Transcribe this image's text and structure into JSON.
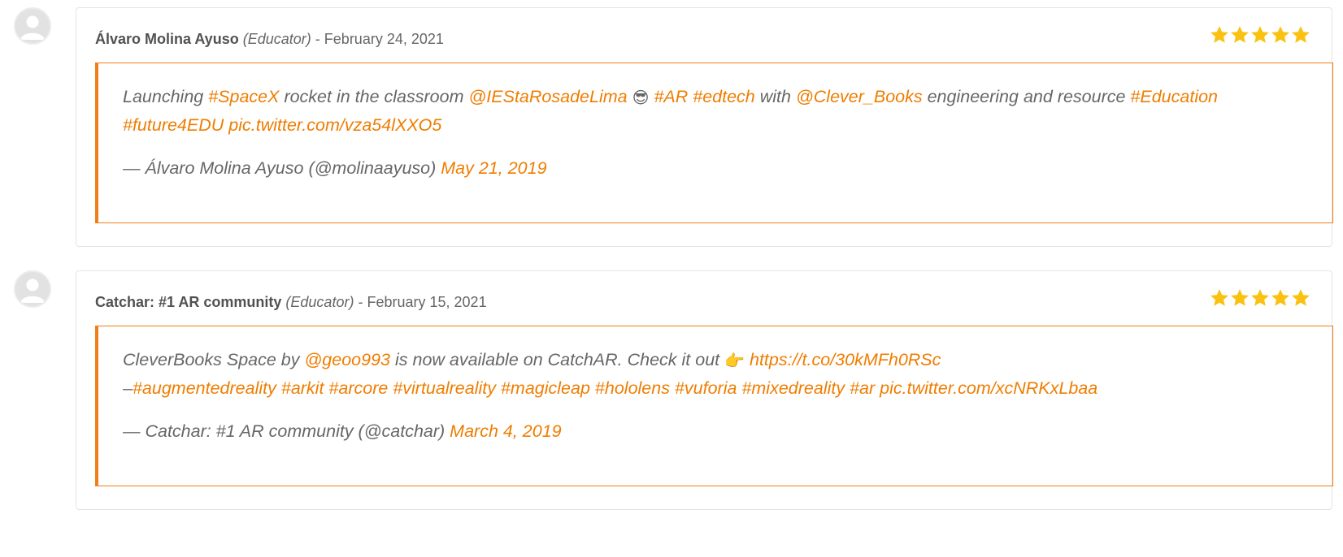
{
  "colors": {
    "accent": "#ef7d00",
    "star": "#fbc10f",
    "text": "#666666",
    "author": "#515151"
  },
  "reviews": [
    {
      "author": "Álvaro Molina Ayuso",
      "role": "(Educator)",
      "separator": "-",
      "date": "February 24, 2021",
      "rating": 5,
      "tweet": {
        "t1": "Launching ",
        "l1": "#SpaceX",
        "t2": " rocket in the classroom ",
        "l2": "@IEStaRosadeLima",
        "emoji": "😎",
        "l3": "#AR",
        "l4": "#edtech",
        "t3": " with ",
        "l5": "@Clever_Books",
        "t4": " engineering and resource ",
        "l6": "#Education",
        "l7": "#future4EDU",
        "l8": "pic.twitter.com/vza54lXXO5",
        "sig_text": "— Álvaro Molina Ayuso (@molinaayuso) ",
        "sig_date": "May 21, 2019"
      }
    },
    {
      "author": "Catchar: #1 AR community",
      "role": "(Educator)",
      "separator": "-",
      "date": "February 15, 2021",
      "rating": 5,
      "tweet": {
        "t1": "CleverBooks Space by ",
        "l1": "@geoo993",
        "t2": " is now available on CatchAR. Check it out ",
        "emoji": "👉",
        "l2": "https://t.co/30kMFh0RSc",
        "t3": "–",
        "l3": "#augmentedreality",
        "l4": "#arkit",
        "l5": "#arcore",
        "l6": "#virtualreality",
        "l7": "#magicleap",
        "l8": "#hololens",
        "l9": "#vuforia",
        "l10": "#mixedreality",
        "l11": "#ar",
        "l12": "pic.twitter.com/xcNRKxLbaa",
        "sig_text": "— Catchar: #1 AR community (@catchar) ",
        "sig_date": "March 4, 2019"
      }
    }
  ]
}
